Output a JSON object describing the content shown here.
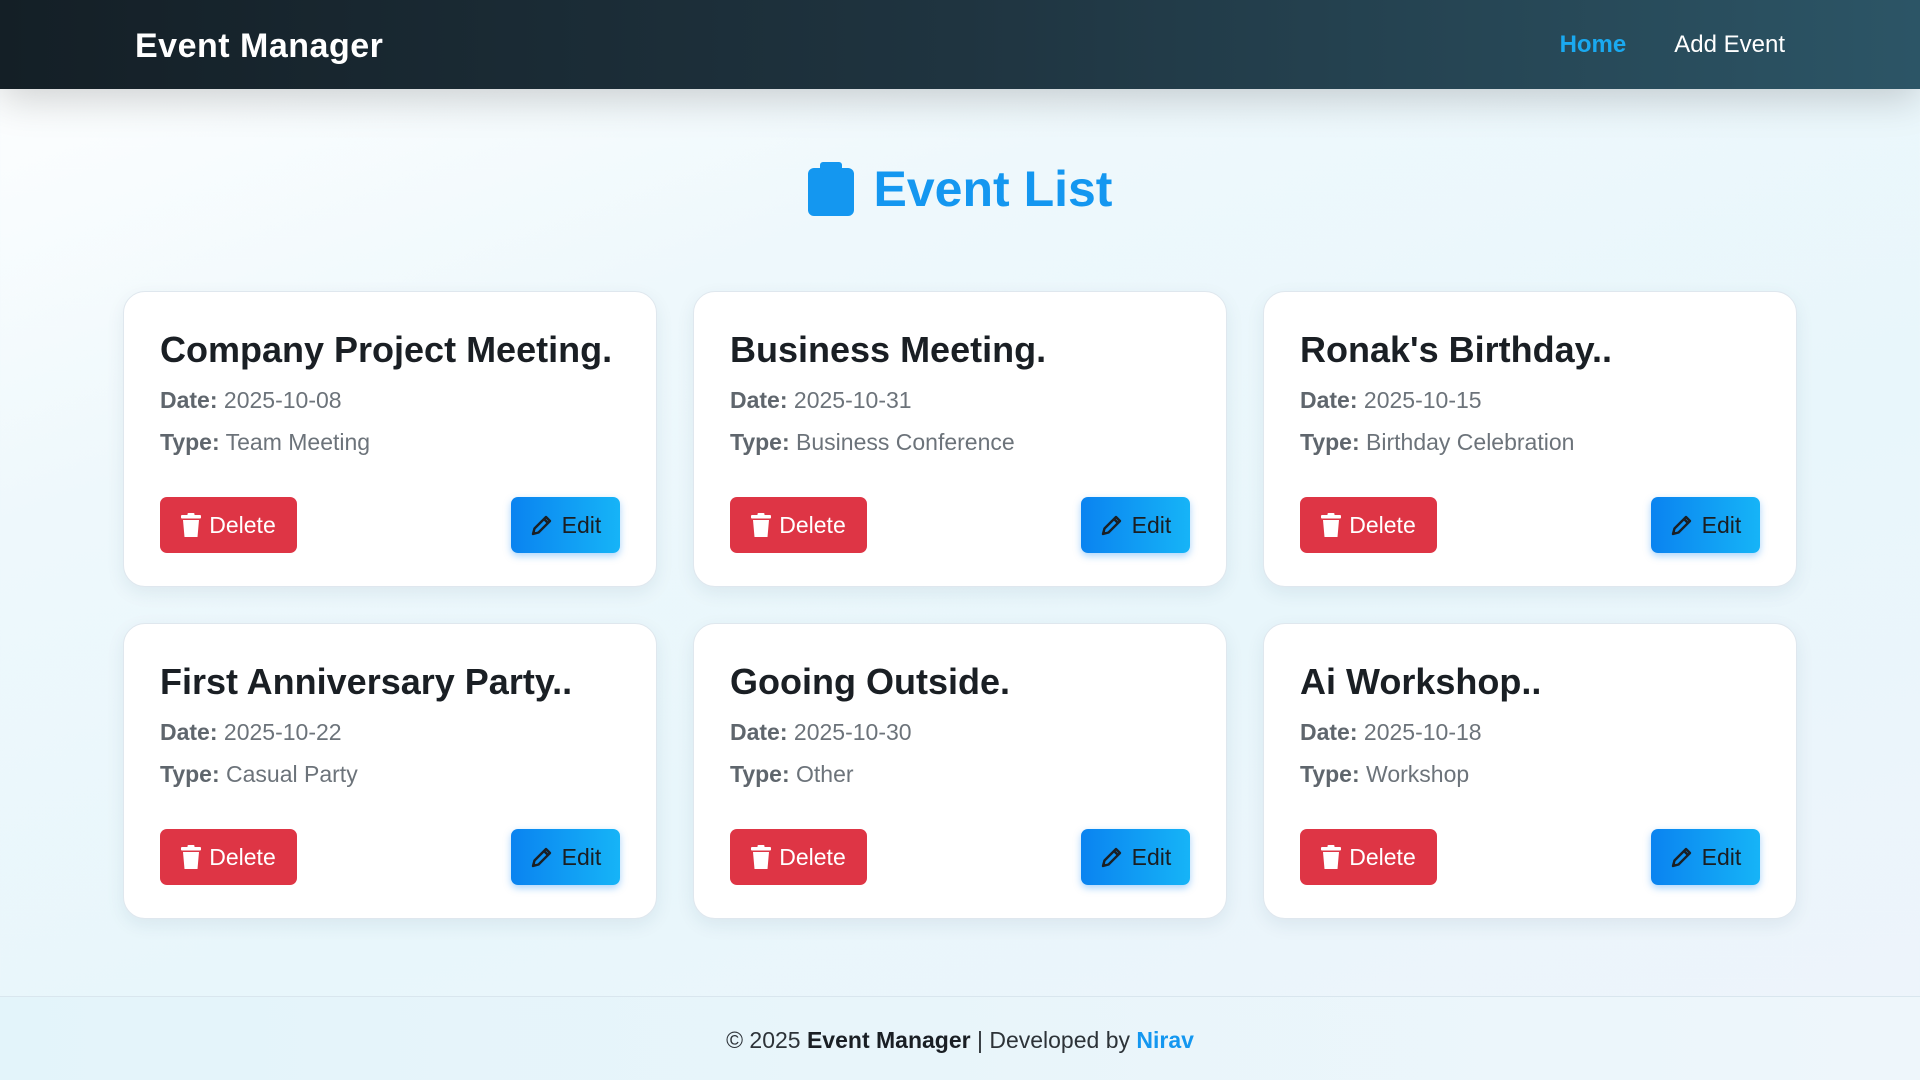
{
  "navbar": {
    "brand": "Event Manager",
    "links": [
      {
        "label": "Home",
        "active": true
      },
      {
        "label": "Add Event",
        "active": false
      }
    ]
  },
  "page": {
    "title": "Event List",
    "title_icon": "clipboard-icon",
    "accent_color": "#1497f0"
  },
  "labels": {
    "date": "Date:",
    "type": "Type:",
    "delete": "Delete",
    "edit": "Edit"
  },
  "events": [
    {
      "title": "Company Project Meeting.",
      "date": "2025-10-08",
      "type": "Team Meeting"
    },
    {
      "title": "Business Meeting.",
      "date": "2025-10-31",
      "type": "Business Conference"
    },
    {
      "title": "Ronak's Birthday..",
      "date": "2025-10-15",
      "type": "Birthday Celebration"
    },
    {
      "title": "First Anniversary Party..",
      "date": "2025-10-22",
      "type": "Casual Party"
    },
    {
      "title": "Gooing Outside.",
      "date": "2025-10-30",
      "type": "Other"
    },
    {
      "title": "Ai Workshop..",
      "date": "2025-10-18",
      "type": "Workshop"
    }
  ],
  "footer": {
    "prefix": "© 2025 ",
    "brand": "Event Manager",
    "middle": " | Developed by ",
    "developer": "Nirav"
  },
  "colors": {
    "delete_button": "#de3545",
    "edit_button": "#0a83f0",
    "nav_active": "#1aa9f0"
  }
}
